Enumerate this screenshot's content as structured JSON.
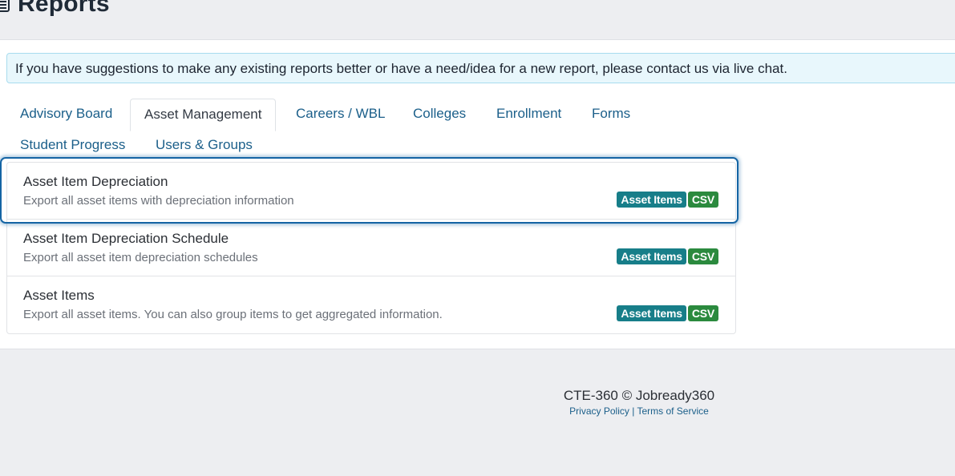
{
  "header": {
    "title": "Reports",
    "icon": "report-icon"
  },
  "alert": {
    "text": "If you have suggestions to make any existing reports better or have a need/idea for a new report, please contact us via live chat."
  },
  "tabs": [
    {
      "label": "Advisory Board",
      "active": false
    },
    {
      "label": "Asset Management",
      "active": true
    },
    {
      "label": "Careers / WBL",
      "active": false
    },
    {
      "label": "Colleges",
      "active": false
    },
    {
      "label": "Enrollment",
      "active": false
    },
    {
      "label": "Forms",
      "active": false
    },
    {
      "label": "Student Progress",
      "active": false
    },
    {
      "label": "Users & Groups",
      "active": false
    }
  ],
  "reports": [
    {
      "title": "Asset Item Depreciation",
      "description": "Export all asset items with depreciation information",
      "badge_type": "Asset Items",
      "badge_format": "CSV",
      "focused": true
    },
    {
      "title": "Asset Item Depreciation Schedule",
      "description": "Export all asset item depreciation schedules",
      "badge_type": "Asset Items",
      "badge_format": "CSV",
      "focused": false
    },
    {
      "title": "Asset Items",
      "description": "Export all asset items. You can also group items to get aggregated information.",
      "badge_type": "Asset Items",
      "badge_format": "CSV",
      "focused": false
    }
  ],
  "footer": {
    "copyright": "CTE-360 © Jobready360",
    "privacy_label": "Privacy Policy",
    "separator": "|",
    "terms_label": "Terms of Service"
  },
  "colors": {
    "link": "#1b5f8a",
    "badge_type": "#177e89",
    "badge_format": "#2b8a3e",
    "alert_bg": "#e8f7fc",
    "focus_ring": "#1464a4"
  }
}
